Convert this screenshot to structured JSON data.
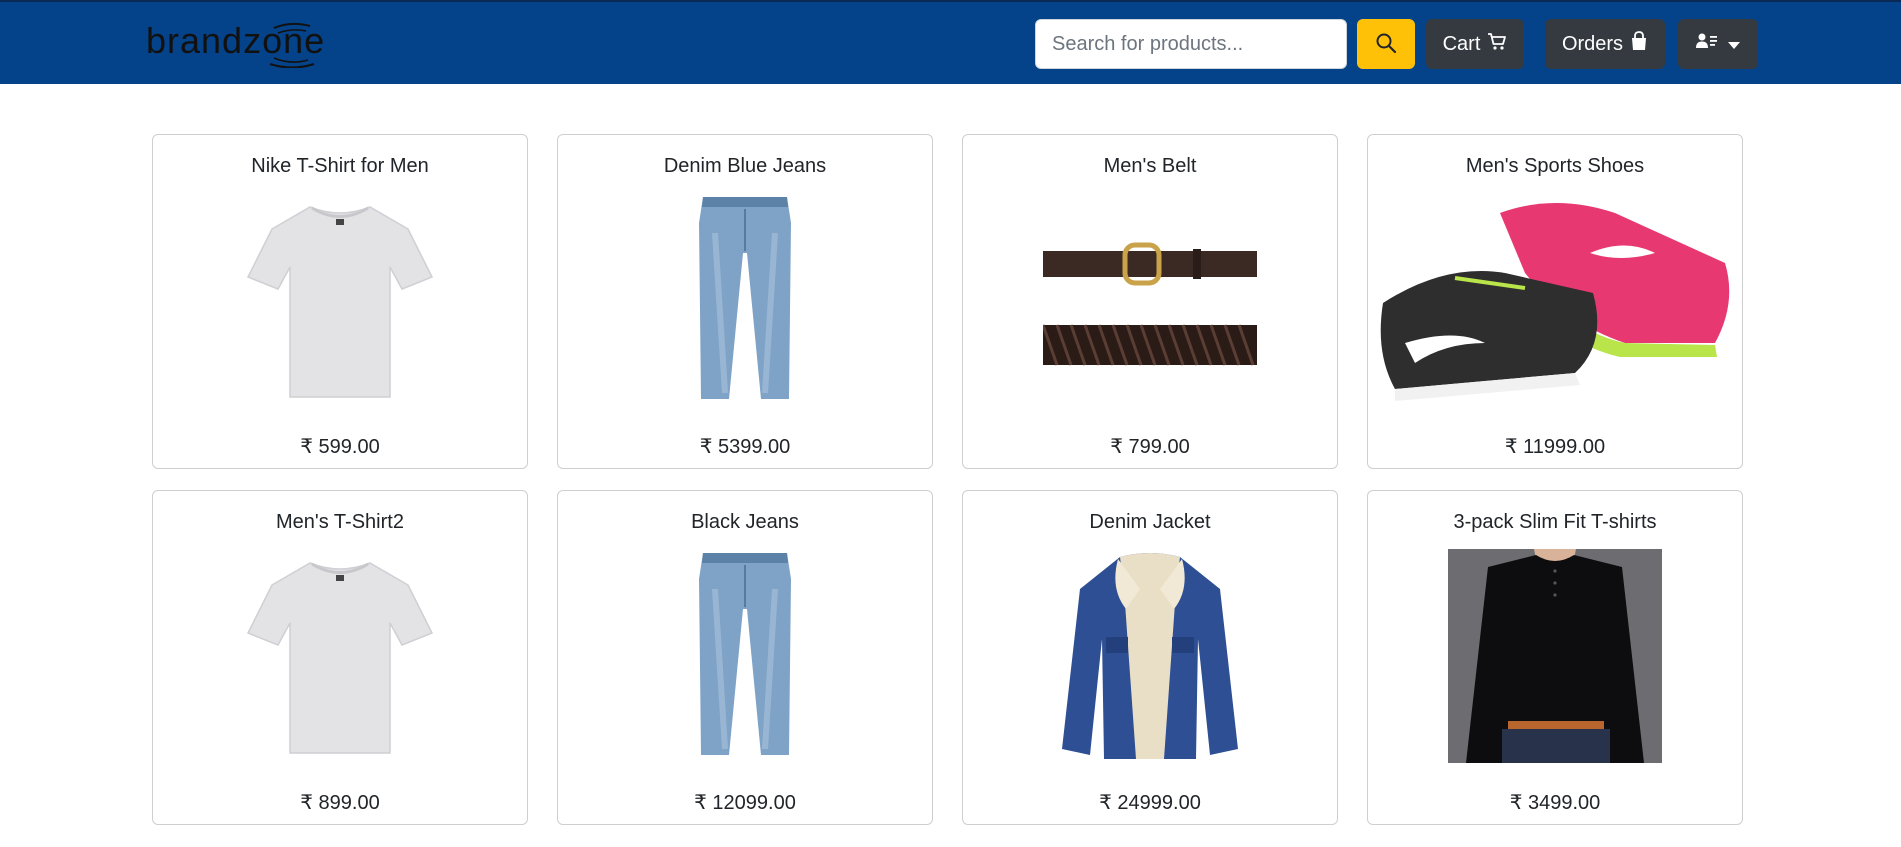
{
  "header": {
    "brand": "brandzone",
    "search": {
      "placeholder": "Search for products...",
      "value": ""
    },
    "cart_label": "Cart",
    "orders_label": "Orders",
    "colors": {
      "navbar": "#044389",
      "search_button": "#ffc107",
      "dark_button": "#343a40"
    }
  },
  "products": [
    {
      "title": "Nike T-Shirt for Men",
      "price": "₹ 599.00",
      "image": "grey-tshirt"
    },
    {
      "title": "Denim Blue Jeans",
      "price": "₹ 5399.00",
      "image": "blue-jeans"
    },
    {
      "title": "Men's Belt",
      "price": "₹ 799.00",
      "image": "belt"
    },
    {
      "title": "Men's Sports Shoes",
      "price": "₹ 11999.00",
      "image": "sports-shoes"
    },
    {
      "title": "Men's T-Shirt2",
      "price": "₹ 899.00",
      "image": "grey-tshirt"
    },
    {
      "title": "Black Jeans",
      "price": "₹ 12099.00",
      "image": "blue-jeans"
    },
    {
      "title": "Denim Jacket",
      "price": "₹ 24999.00",
      "image": "denim-jacket"
    },
    {
      "title": "3-pack Slim Fit T-shirts",
      "price": "₹ 3499.00",
      "image": "black-henley-tshirt"
    }
  ]
}
